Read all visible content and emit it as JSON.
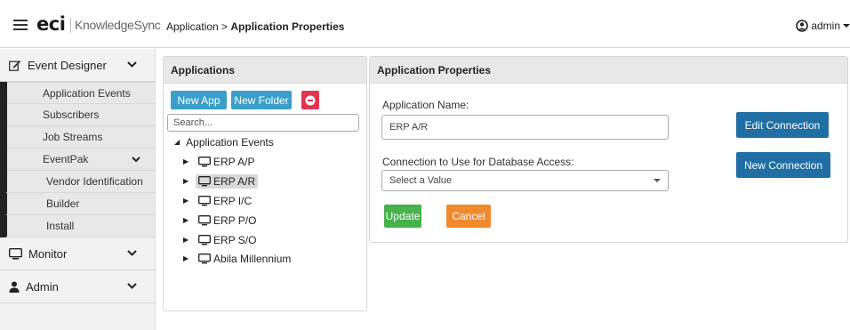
{
  "header": {
    "brand": "eci",
    "product": "KnowledgeSync",
    "breadcrumb_parent": "Application >",
    "breadcrumb_current": "Application Properties",
    "user": "admin"
  },
  "sidebar": {
    "event_designer": "Event Designer",
    "items": [
      "Application Events",
      "Subscribers",
      "Job Streams"
    ],
    "eventpak": "EventPak",
    "eventpak_items": [
      "Vendor Identification",
      "Builder",
      "Install"
    ],
    "monitor": "Monitor",
    "admin": "Admin"
  },
  "applications": {
    "title": "Applications",
    "new_app": "New App",
    "new_folder": "New Folder",
    "search_placeholder": "Search...",
    "root": "Application Events",
    "nodes": [
      "ERP A/P",
      "ERP A/R",
      "ERP I/C",
      "ERP P/O",
      "ERP S/O",
      "Abila Millennium"
    ],
    "selected": "ERP A/R"
  },
  "properties": {
    "title": "Application Properties",
    "name_label": "Application Name:",
    "name_value": "ERP A/R",
    "connection_label": "Connection to Use for Database Access:",
    "connection_value": "Select a Value",
    "edit_connection": "Edit Connection",
    "new_connection": "New Connection",
    "update": "Update",
    "cancel": "Cancel"
  }
}
